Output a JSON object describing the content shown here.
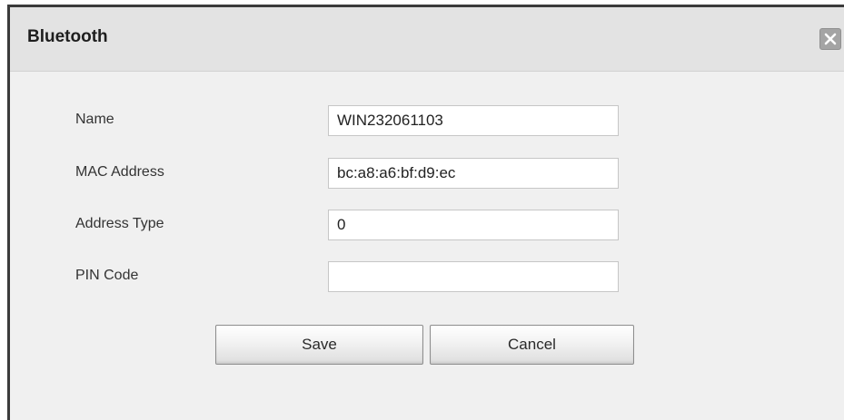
{
  "dialog": {
    "title": "Bluetooth",
    "close_icon": "close-icon"
  },
  "fields": [
    {
      "label": "Name",
      "value": "WIN232061103"
    },
    {
      "label": "MAC Address",
      "value": "bc:a8:a6:bf:d9:ec"
    },
    {
      "label": "Address Type",
      "value": "0"
    },
    {
      "label": "PIN Code",
      "value": ""
    }
  ],
  "buttons": {
    "save_label": "Save",
    "cancel_label": "Cancel"
  }
}
